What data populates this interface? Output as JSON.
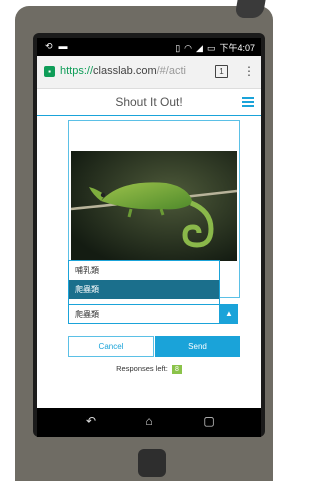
{
  "status_bar": {
    "left_icons": [
      "sync-icon",
      "image-icon"
    ],
    "right_icons": [
      "vibrate-icon",
      "wifi-icon",
      "signal-icon",
      "battery-icon"
    ],
    "time": "下午4:07"
  },
  "browser": {
    "url_scheme": "https://",
    "url_host": "classlab.com",
    "url_rest": "/#/acti",
    "tab_count": "1"
  },
  "app": {
    "title": "Shout It Out!"
  },
  "dropdown": {
    "options": [
      "哺乳類",
      "爬蟲類"
    ],
    "selected_index": 1,
    "selected_value": "爬蟲類"
  },
  "buttons": {
    "cancel": "Cancel",
    "send": "Send"
  },
  "responses": {
    "label": "Responses left:",
    "count": "8"
  },
  "colors": {
    "accent": "#1aa3d9",
    "badge_green": "#8bc34a",
    "selected_option": "#1b6f8c"
  }
}
